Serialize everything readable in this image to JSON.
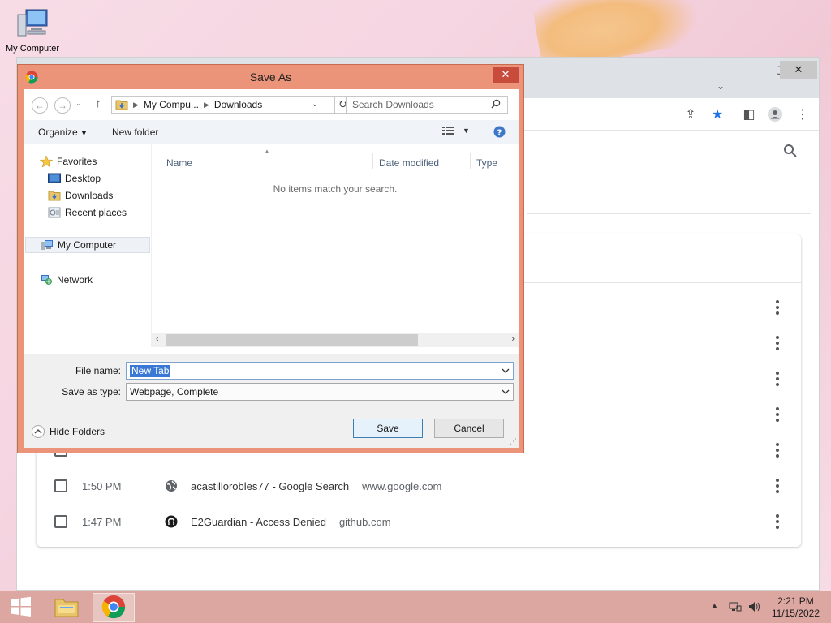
{
  "desktop": {
    "icons": [
      {
        "label": "My Computer",
        "icon": "computer-icon"
      }
    ]
  },
  "chrome": {
    "history": [
      {
        "time": "",
        "title": "",
        "domain": "",
        "icon": "globe-icon"
      },
      {
        "time": "",
        "title": "",
        "domain": "",
        "icon": "globe-icon"
      },
      {
        "time": "",
        "title": "",
        "domain": "",
        "icon": "globe-icon"
      },
      {
        "time": "",
        "title": "",
        "domain": "",
        "icon": "globe-icon"
      },
      {
        "time": "",
        "title": "",
        "domain": "",
        "icon": "globe-icon"
      },
      {
        "time": "1:50 PM",
        "title": "acastillorobles77 - Google Search",
        "domain": "www.google.com",
        "icon": "globe-icon"
      },
      {
        "time": "1:47 PM",
        "title": "E2Guardian - Access Denied",
        "domain": "github.com",
        "icon": "github-icon"
      }
    ],
    "accent": "#1a73e8"
  },
  "dialog": {
    "title": "Save As",
    "address": {
      "segments": [
        "My Compu...",
        "Downloads"
      ]
    },
    "search_placeholder": "Search Downloads",
    "toolbar": {
      "organize": "Organize",
      "new_folder": "New folder"
    },
    "nav": {
      "favorites": "Favorites",
      "desktop": "Desktop",
      "downloads": "Downloads",
      "recent": "Recent places",
      "my_computer": "My Computer",
      "network": "Network"
    },
    "columns": {
      "name": "Name",
      "date_modified": "Date modified",
      "type": "Type"
    },
    "empty_message": "No items match your search.",
    "file_name_label": "File name:",
    "file_name_value": "New Tab",
    "save_type_label": "Save as type:",
    "save_type_value": "Webpage, Complete",
    "hide_folders": "Hide Folders",
    "save_button": "Save",
    "cancel_button": "Cancel",
    "frame_color": "#eb9479",
    "close_color": "#c74c3c"
  },
  "taskbar": {
    "time": "2:21 PM",
    "date": "11/15/2022"
  }
}
